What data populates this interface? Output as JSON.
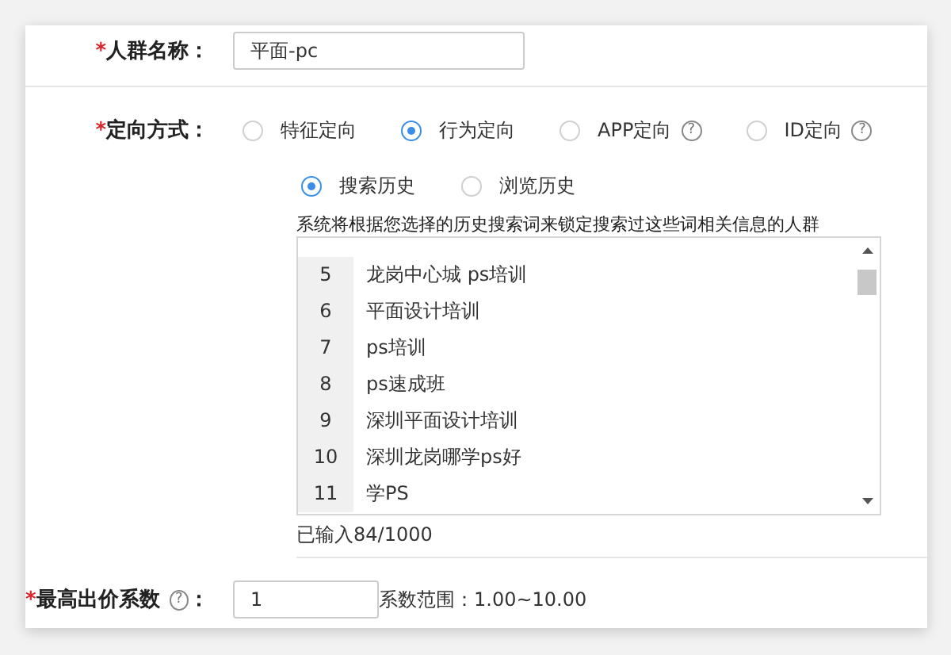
{
  "name_field": {
    "label": "人群名称：",
    "mark": "*",
    "value": "平面-pc"
  },
  "targeting": {
    "label": "定向方式：",
    "mark": "*",
    "options": [
      {
        "label": "特征定向",
        "selected": false
      },
      {
        "label": "行为定向",
        "selected": true
      },
      {
        "label": "APP定向",
        "selected": false,
        "help": "?"
      },
      {
        "label": "ID定向",
        "selected": false,
        "help": "?"
      }
    ],
    "sub_options": [
      {
        "label": "搜索历史",
        "selected": true
      },
      {
        "label": "浏览历史",
        "selected": false
      }
    ],
    "hint": "系统将根据您选择的历史搜索词来锁定搜索过这些词相关信息的人群",
    "keywords": [
      {
        "number": "5",
        "text": "龙岗中心城 ps培训"
      },
      {
        "number": "6",
        "text": "平面设计培训"
      },
      {
        "number": "7",
        "text": "ps培训"
      },
      {
        "number": "8",
        "text": "ps速成班"
      },
      {
        "number": "9",
        "text": "深圳平面设计培训"
      },
      {
        "number": "10",
        "text": "深圳龙岗哪学ps好"
      },
      {
        "number": "11",
        "text": "学PS"
      }
    ],
    "counter": "已输入84/1000"
  },
  "bid": {
    "label": "最高出价系数",
    "mark": "*",
    "help": "?",
    "colon": "：",
    "value": "1",
    "range": "系数范围：1.00~10.00"
  }
}
